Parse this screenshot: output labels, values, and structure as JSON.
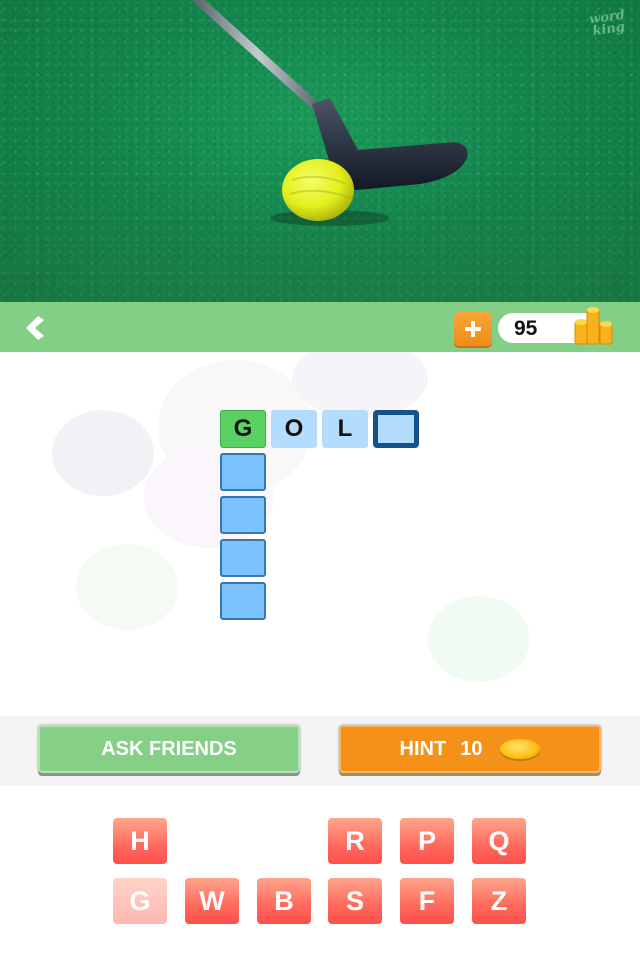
{
  "photo": {
    "subject": "golf club putting yellow ball on green turf",
    "watermark_line1": "word",
    "watermark_line2": "king"
  },
  "topbar": {
    "back_icon": "chevron-left-icon",
    "add_coins_icon": "plus-icon",
    "coin_count": "95",
    "coins_icon": "coin-stack-icon"
  },
  "puzzle": {
    "across": [
      {
        "letter": "G",
        "state": "correct"
      },
      {
        "letter": "O",
        "state": "filled"
      },
      {
        "letter": "L",
        "state": "filled"
      },
      {
        "letter": "",
        "state": "selected"
      }
    ],
    "down": [
      {
        "letter": "",
        "state": "empty"
      },
      {
        "letter": "",
        "state": "empty"
      },
      {
        "letter": "",
        "state": "empty"
      },
      {
        "letter": "",
        "state": "empty"
      }
    ]
  },
  "actions": {
    "ask_friends_label": "ASK FRIENDS",
    "hint_label": "HINT",
    "hint_cost": "10",
    "hint_icon": "coin-icon"
  },
  "keyboard": {
    "row1": [
      {
        "letter": "H",
        "used": false
      },
      {
        "letter": "",
        "used": true,
        "hidden": true
      },
      {
        "letter": "",
        "used": true,
        "hidden": true
      },
      {
        "letter": "R",
        "used": false
      },
      {
        "letter": "P",
        "used": false
      },
      {
        "letter": "Q",
        "used": false
      }
    ],
    "row2": [
      {
        "letter": "G",
        "used": true
      },
      {
        "letter": "W",
        "used": false
      },
      {
        "letter": "B",
        "used": false
      },
      {
        "letter": "S",
        "used": false
      },
      {
        "letter": "F",
        "used": false
      },
      {
        "letter": "Z",
        "used": false
      }
    ]
  },
  "colors": {
    "topbar_green": "#84cf86",
    "correct_tile": "#5bd164",
    "filled_tile": "#b3dcfd",
    "empty_tile": "#7cc2ff",
    "selected_border": "#14528a",
    "hint_orange": "#f49118",
    "key_red": "#ff6a5c"
  }
}
